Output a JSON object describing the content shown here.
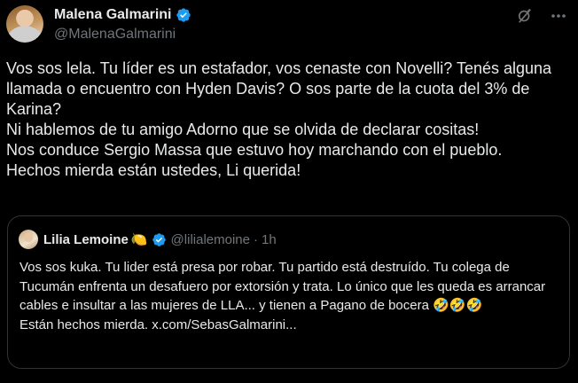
{
  "tweet": {
    "author_name": "Malena Galmarini",
    "author_handle": "@MalenaGalmarini",
    "text": "Vos sos lela. Tu líder es un estafador, vos cenaste con Novelli? Tenés alguna llamada o encuentro con Hyden Davis? O sos parte de la cuota del 3% de Karina?\nNi hablemos de tu amigo Adorno que se olvida de declarar cositas!\nNos conduce Sergio Massa que estuvo hoy marchando con el pueblo.\nHechos mierda están ustedes, Li querida!",
    "icons": {
      "verified": "verified-badge-icon",
      "grok": "grok-icon",
      "more": "more-icon"
    }
  },
  "quote": {
    "author_name": "Lilia Lemoine",
    "author_emoji": "🍋",
    "author_handle": "@lilialemoine",
    "separator": "·",
    "time": "1h",
    "text": "Vos sos kuka. Tu lider está presa por robar. Tu partido está destruído. Tu colega de Tucumán enfrenta un desafuero por extorsión y trata. Lo único que les queda es arrancar cables e insultar a las mujeres de LLA... y tienen a Pagano de bocera 🤣🤣🤣\nEstán hechos mierda. x.com/SebasGalmarini..."
  },
  "colors": {
    "background": "#000000",
    "text_primary": "#e7e9ea",
    "text_secondary": "#71767b",
    "verified_blue": "#1d9bf0",
    "border": "#2f3336"
  }
}
